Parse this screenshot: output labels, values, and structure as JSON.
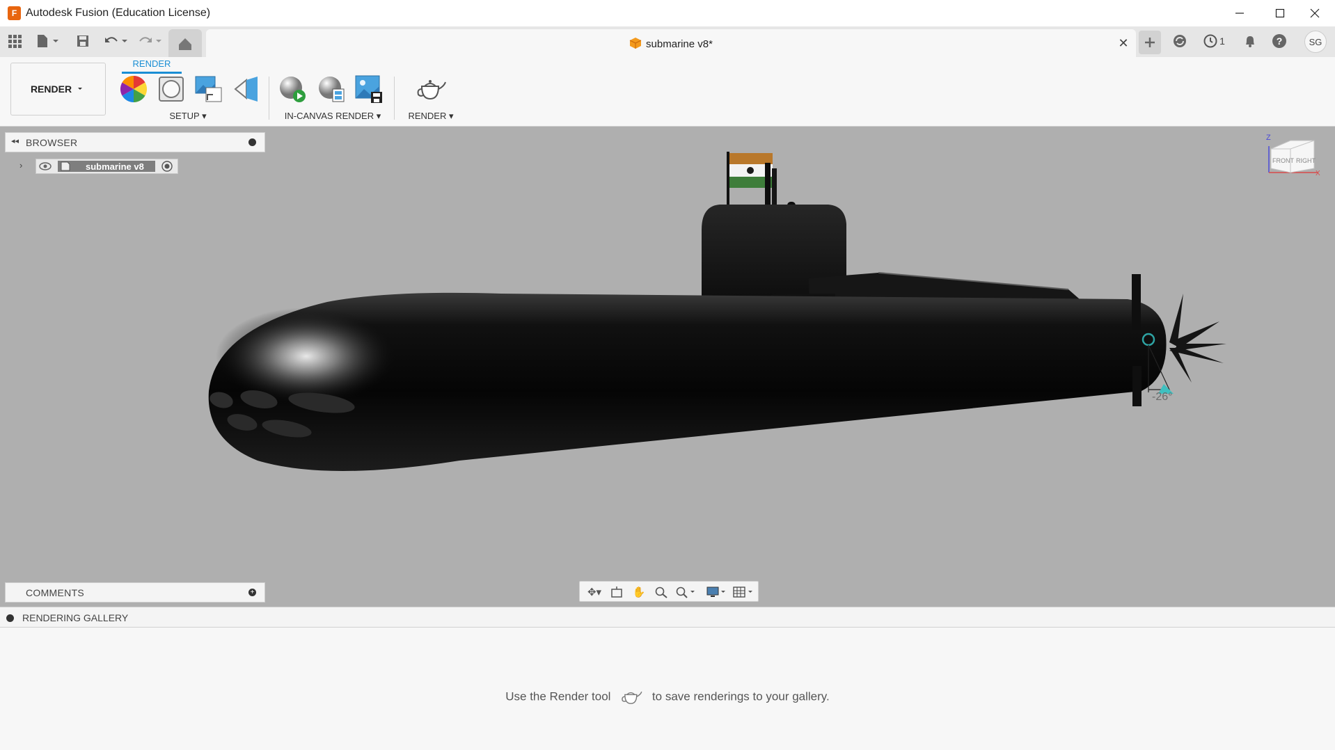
{
  "window": {
    "title": "Autodesk Fusion (Education License)",
    "logo_letter": "F"
  },
  "tabs": {
    "document_title": "submarine v8*",
    "job_count": "1",
    "user_initials": "SG"
  },
  "toolbar": {
    "workspace_label": "RENDER",
    "active_tab": "RENDER",
    "groups": {
      "setup": "SETUP",
      "in_canvas": "IN-CANVAS RENDER",
      "render": "RENDER"
    }
  },
  "browser": {
    "title": "BROWSER",
    "root_item": "submarine v8"
  },
  "comments": {
    "title": "COMMENTS"
  },
  "viewcube": {
    "front": "FRONT",
    "right": "RIGHT",
    "z_axis": "Z",
    "x_axis": "X"
  },
  "viewport": {
    "angle_label": "-26°"
  },
  "gallery": {
    "title": "RENDERING GALLERY",
    "message_before": "Use the Render tool",
    "message_after": "to save renderings to your gallery."
  },
  "colors": {
    "accent": "#1a8ed4",
    "viewport_bg": "#afafaf",
    "brand": "#e8650f"
  }
}
